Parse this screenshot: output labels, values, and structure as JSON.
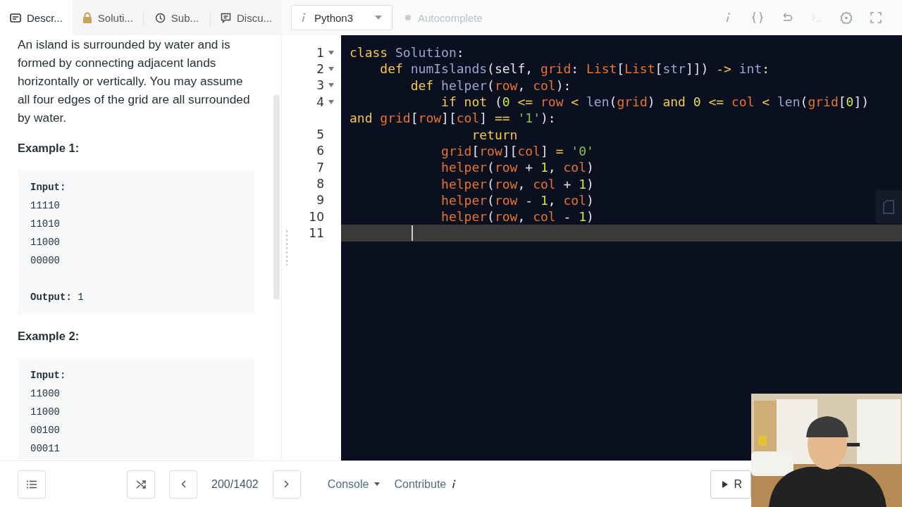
{
  "tabs": [
    {
      "label": "Descr...",
      "kind": "card",
      "selected": true
    },
    {
      "label": "Soluti...",
      "kind": "lock",
      "selected": false
    },
    {
      "label": "Sub...",
      "kind": "clock",
      "selected": false
    },
    {
      "label": "Discu...",
      "kind": "chat",
      "selected": false
    }
  ],
  "language_select": {
    "value": "Python3"
  },
  "autocomplete": {
    "label": "Autocomplete",
    "on": false
  },
  "toolbar_icons": [
    {
      "kind": "info",
      "disabled": false
    },
    {
      "kind": "braces",
      "disabled": false
    },
    {
      "kind": "undo",
      "disabled": false
    },
    {
      "kind": "terminal",
      "disabled": true
    },
    {
      "kind": "settings",
      "disabled": false
    },
    {
      "kind": "fullscreen",
      "disabled": false
    }
  ],
  "description": {
    "paragraph": "An island is surrounded by water and is formed by connecting adjacent lands horizontally or vertically. You may assume all four edges of the grid are all surrounded by water.",
    "examples": [
      {
        "title": "Example 1:",
        "input_label": "Input:",
        "input_lines": [
          "11110",
          "11010",
          "11000",
          "00000"
        ],
        "output": "**Output:** 1"
      },
      {
        "title": "Example 2:",
        "input_label": "Input:",
        "input_lines": [
          "11000",
          "11000",
          "00100",
          "00011"
        ]
      }
    ]
  },
  "code_lines": [
    {
      "number": "1",
      "foldable": true,
      "active": false,
      "tokens": [
        {
          "text": "class ",
          "kind": "keyword"
        },
        {
          "text": "Solution",
          "kind": "name"
        },
        {
          "text": ":",
          "kind": "plain"
        }
      ]
    },
    {
      "number": "2",
      "foldable": true,
      "active": false,
      "tokens": [
        {
          "text": "    def ",
          "kind": "keyword"
        },
        {
          "text": "numIslands",
          "kind": "name"
        },
        {
          "text": "(self, ",
          "kind": "plain"
        },
        {
          "text": "grid",
          "kind": "var"
        },
        {
          "text": ": ",
          "kind": "plain"
        },
        {
          "text": "List",
          "kind": "var"
        },
        {
          "text": "[",
          "kind": "plain"
        },
        {
          "text": "List",
          "kind": "var"
        },
        {
          "text": "[",
          "kind": "plain"
        },
        {
          "text": "str",
          "kind": "name"
        },
        {
          "text": "]]) ",
          "kind": "plain"
        },
        {
          "text": "-> ",
          "kind": "op"
        },
        {
          "text": "int",
          "kind": "name"
        },
        {
          "text": ":",
          "kind": "plain"
        }
      ]
    },
    {
      "number": "3",
      "foldable": true,
      "active": false,
      "tokens": [
        {
          "text": "        def ",
          "kind": "keyword"
        },
        {
          "text": "helper",
          "kind": "name"
        },
        {
          "text": "(",
          "kind": "plain"
        },
        {
          "text": "row",
          "kind": "var"
        },
        {
          "text": ", ",
          "kind": "plain"
        },
        {
          "text": "col",
          "kind": "var"
        },
        {
          "text": "):",
          "kind": "plain"
        }
      ]
    },
    {
      "number": "4",
      "foldable": true,
      "active": false,
      "tokens": [
        {
          "text": "            if not",
          "kind": "keyword"
        },
        {
          "text": " (",
          "kind": "plain"
        },
        {
          "text": "0 ",
          "kind": "number"
        },
        {
          "text": "<= ",
          "kind": "op"
        },
        {
          "text": "row ",
          "kind": "var"
        },
        {
          "text": "< ",
          "kind": "op"
        },
        {
          "text": "len",
          "kind": "name"
        },
        {
          "text": "(",
          "kind": "plain"
        },
        {
          "text": "grid",
          "kind": "var"
        },
        {
          "text": ") ",
          "kind": "plain"
        },
        {
          "text": "and ",
          "kind": "keyword"
        },
        {
          "text": "0 ",
          "kind": "number"
        },
        {
          "text": "<= ",
          "kind": "op"
        },
        {
          "text": "col ",
          "kind": "var"
        },
        {
          "text": "< ",
          "kind": "op"
        },
        {
          "text": "len",
          "kind": "name"
        },
        {
          "text": "(",
          "kind": "plain"
        },
        {
          "text": "grid",
          "kind": "var"
        },
        {
          "text": "[",
          "kind": "plain"
        },
        {
          "text": "0",
          "kind": "number"
        },
        {
          "text": "])",
          "kind": "plain"
        }
      ],
      "continuation": {
        "tokens": [
          {
            "text": "and ",
            "kind": "keyword"
          },
          {
            "text": "grid",
            "kind": "var"
          },
          {
            "text": "[",
            "kind": "plain"
          },
          {
            "text": "row",
            "kind": "var"
          },
          {
            "text": "][",
            "kind": "plain"
          },
          {
            "text": "col",
            "kind": "var"
          },
          {
            "text": "] ",
            "kind": "plain"
          },
          {
            "text": "== ",
            "kind": "op"
          },
          {
            "text": "'1'",
            "kind": "string"
          },
          {
            "text": "):",
            "kind": "plain"
          }
        ]
      }
    },
    {
      "number": "5",
      "foldable": false,
      "active": false,
      "tokens": [
        {
          "text": "                return",
          "kind": "keyword"
        }
      ]
    },
    {
      "number": "6",
      "foldable": false,
      "active": false,
      "tokens": [
        {
          "text": "            grid",
          "kind": "var"
        },
        {
          "text": "[",
          "kind": "plain"
        },
        {
          "text": "row",
          "kind": "var"
        },
        {
          "text": "][",
          "kind": "plain"
        },
        {
          "text": "col",
          "kind": "var"
        },
        {
          "text": "] ",
          "kind": "plain"
        },
        {
          "text": "= ",
          "kind": "op"
        },
        {
          "text": "'0'",
          "kind": "string"
        }
      ]
    },
    {
      "number": "7",
      "foldable": false,
      "active": false,
      "tokens": [
        {
          "text": "            helper",
          "kind": "var"
        },
        {
          "text": "(",
          "kind": "plain"
        },
        {
          "text": "row",
          "kind": "var"
        },
        {
          "text": " + ",
          "kind": "plain"
        },
        {
          "text": "1",
          "kind": "number"
        },
        {
          "text": ", ",
          "kind": "plain"
        },
        {
          "text": "col",
          "kind": "var"
        },
        {
          "text": ")",
          "kind": "plain"
        }
      ]
    },
    {
      "number": "8",
      "foldable": false,
      "active": false,
      "tokens": [
        {
          "text": "            helper",
          "kind": "var"
        },
        {
          "text": "(",
          "kind": "plain"
        },
        {
          "text": "row",
          "kind": "var"
        },
        {
          "text": ", ",
          "kind": "plain"
        },
        {
          "text": "col",
          "kind": "var"
        },
        {
          "text": " + ",
          "kind": "plain"
        },
        {
          "text": "1",
          "kind": "number"
        },
        {
          "text": ")",
          "kind": "plain"
        }
      ]
    },
    {
      "number": "9",
      "foldable": false,
      "active": false,
      "tokens": [
        {
          "text": "            helper",
          "kind": "var"
        },
        {
          "text": "(",
          "kind": "plain"
        },
        {
          "text": "row",
          "kind": "var"
        },
        {
          "text": " - ",
          "kind": "plain"
        },
        {
          "text": "1",
          "kind": "number"
        },
        {
          "text": ", ",
          "kind": "plain"
        },
        {
          "text": "col",
          "kind": "var"
        },
        {
          "text": ")",
          "kind": "plain"
        }
      ]
    },
    {
      "number": "10",
      "foldable": false,
      "active": false,
      "tokens": [
        {
          "text": "            helper",
          "kind": "var"
        },
        {
          "text": "(",
          "kind": "plain"
        },
        {
          "text": "row",
          "kind": "var"
        },
        {
          "text": ", ",
          "kind": "plain"
        },
        {
          "text": "col",
          "kind": "var"
        },
        {
          "text": " - ",
          "kind": "plain"
        },
        {
          "text": "1",
          "kind": "number"
        },
        {
          "text": ")",
          "kind": "plain"
        }
      ]
    },
    {
      "number": "11",
      "foldable": false,
      "active": true
    }
  ],
  "bottom_bar": {
    "counter": "200/1402",
    "console": "Console",
    "contribute": "Contribute",
    "run": "R"
  }
}
